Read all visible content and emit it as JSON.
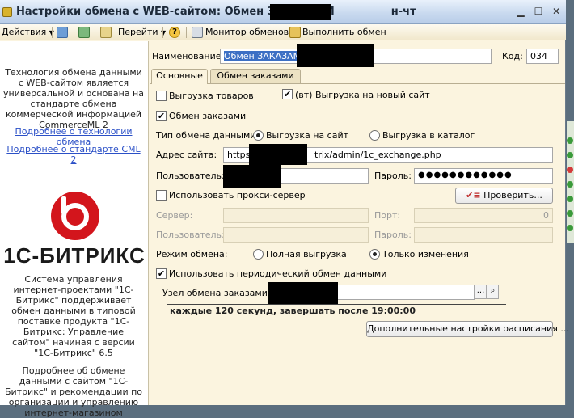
{
  "window": {
    "title_prefix": "Настройки обмена с WEB-сайтом: Обмен ЗАКАЗАМИ",
    "title_suffix": "н-чт",
    "close_icon": "close-icon",
    "maximize_icon": "maximize-icon",
    "minimize_icon": "minimize-icon"
  },
  "toolbar": {
    "actions_label": "Действия",
    "goto_label": "Перейти",
    "help_label": "?",
    "monitor_label": "Монитор обменов",
    "execute_label": "Выполнить обмен"
  },
  "left_panel": {
    "intro_text": "Технология обмена данными с WEB-сайтом является универсальной и основана на стандарте обмена коммерческой информацией CommerceML 2",
    "link_technology": "Подробнее о технологии обмена",
    "link_standard": "Подробнее о стандарте CML 2",
    "logo_text": "1С-БИТРИКС",
    "product_text": "Система управления интернет-проектами \"1С-Битрикс\" поддерживает обмен данными в типовой поставке продукта \"1С-Битрикс: Управление сайтом\" начиная с версии \"1С-Битрикс\" 6.5",
    "bottom_text": "Подробнее об обмене данными с сайтом \"1С-Битрикс\" и рекомендации по организации и управлению интернет-магазином"
  },
  "form": {
    "name_label": "Наименование:",
    "name_value": "Обмен ЗАКАЗАМИ",
    "code_label": "Код:",
    "code_value": "034",
    "tabs": [
      {
        "label": "Основные"
      },
      {
        "label": "Обмен заказами"
      }
    ],
    "upload_goods_label": "Выгрузка товаров",
    "upload_new_site_label": "(вт) Выгрузка на новый сайт",
    "order_exchange_label": "Обмен заказами",
    "exchange_type_label": "Тип обмена данными:",
    "upload_to_site_label": "Выгрузка на сайт",
    "upload_to_catalog_label": "Выгрузка в каталог",
    "site_address_label": "Адрес сайта:",
    "site_address_start": "https:",
    "site_address_end": "trix/admin/1c_exchange.php",
    "user_label": "Пользователь:",
    "password_label": "Пароль:",
    "password_value": "●●●●●●●●●●●●",
    "use_proxy_label": "Использовать прокси-сервер",
    "check_button": "Проверить...",
    "server_label": "Сервер:",
    "port_label": "Порт:",
    "port_value": "0",
    "proxy_user_label": "Пользователь:",
    "proxy_password_label": "Пароль:",
    "exchange_mode_label": "Режим обмена:",
    "full_upload_label": "Полная выгрузка",
    "only_changes_label": "Только изменения",
    "periodic_label": "Использовать периодический обмен данными",
    "node_label": "Узел обмена заказами:",
    "schedule_text": "каждые 120 секунд, завершать после 19:00:00",
    "schedule_button": "Дополнительные настройки расписания ...",
    "ellipsis_button": "...",
    "search_icon": "search-icon"
  },
  "colors": {
    "form_bg": "#fbf4df",
    "title_gradient_top": "#e9f1fb",
    "logo_red": "#d3151c",
    "link_blue": "#2b50c7"
  }
}
